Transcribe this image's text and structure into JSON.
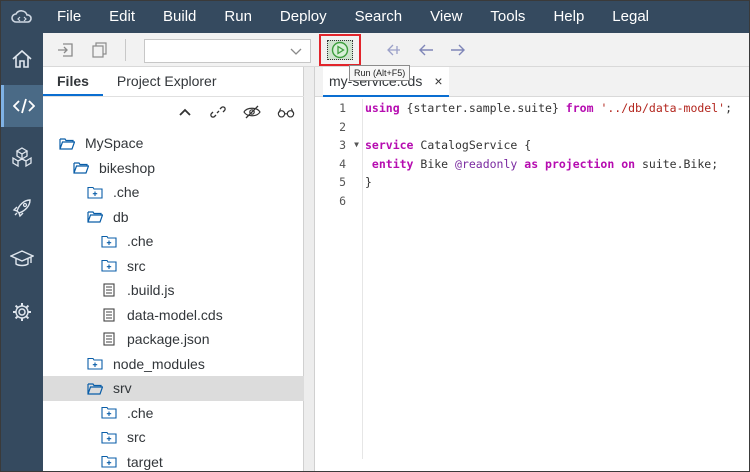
{
  "menu": {
    "items": [
      "File",
      "Edit",
      "Build",
      "Run",
      "Deploy",
      "Search",
      "View",
      "Tools",
      "Help",
      "Legal"
    ]
  },
  "activity_bar": {
    "items": [
      "home-icon",
      "code-icon",
      "cubes-icon",
      "rocket-icon",
      "graduation-cap-icon",
      "gear-icon"
    ],
    "active": "code-icon"
  },
  "toolbar": {
    "run_tooltip": "Run (Alt+F5)",
    "run_config_value": ""
  },
  "explorer": {
    "tabs": [
      "Files",
      "Project Explorer"
    ],
    "active_tab": "Files",
    "tree": [
      {
        "label": "MySpace",
        "depth": 0,
        "type": "folder-open"
      },
      {
        "label": "bikeshop",
        "depth": 1,
        "type": "folder-open"
      },
      {
        "label": ".che",
        "depth": 2,
        "type": "folder-plus"
      },
      {
        "label": "db",
        "depth": 2,
        "type": "folder-open"
      },
      {
        "label": ".che",
        "depth": 3,
        "type": "folder-plus"
      },
      {
        "label": "src",
        "depth": 3,
        "type": "folder-plus"
      },
      {
        "label": ".build.js",
        "depth": 3,
        "type": "file"
      },
      {
        "label": "data-model.cds",
        "depth": 3,
        "type": "file"
      },
      {
        "label": "package.json",
        "depth": 3,
        "type": "file"
      },
      {
        "label": "node_modules",
        "depth": 2,
        "type": "folder-plus"
      },
      {
        "label": "srv",
        "depth": 2,
        "type": "folder-open",
        "selected": true
      },
      {
        "label": ".che",
        "depth": 3,
        "type": "folder-plus"
      },
      {
        "label": "src",
        "depth": 3,
        "type": "folder-plus"
      },
      {
        "label": "target",
        "depth": 3,
        "type": "folder-plus"
      }
    ]
  },
  "editor": {
    "tab_label": "my-service.cds",
    "close_glyph": "×",
    "line_numbers": [
      "1",
      "2",
      "3",
      "4",
      "5",
      "6"
    ],
    "lines": {
      "l1_kw1": "using",
      "l1_mid": " {starter.sample.suite} ",
      "l1_kw2": "from",
      "l1_sp": " ",
      "l1_str": "'../db/data-model'",
      "l1_end": ";",
      "l3_kw": "service",
      "l3_rest": " CatalogService {",
      "l4_kw1": " entity",
      "l4_mid1": " Bike ",
      "l4_ann": "@readonly",
      "l4_sp": " ",
      "l4_kw2": "as projection on",
      "l4_rest": " suite.Bike;",
      "l5": "}"
    }
  },
  "colors": {
    "shell": "#354a5f",
    "run_highlight": "#e2242b",
    "keyword": "#b60cb0",
    "string": "#b3261e"
  }
}
